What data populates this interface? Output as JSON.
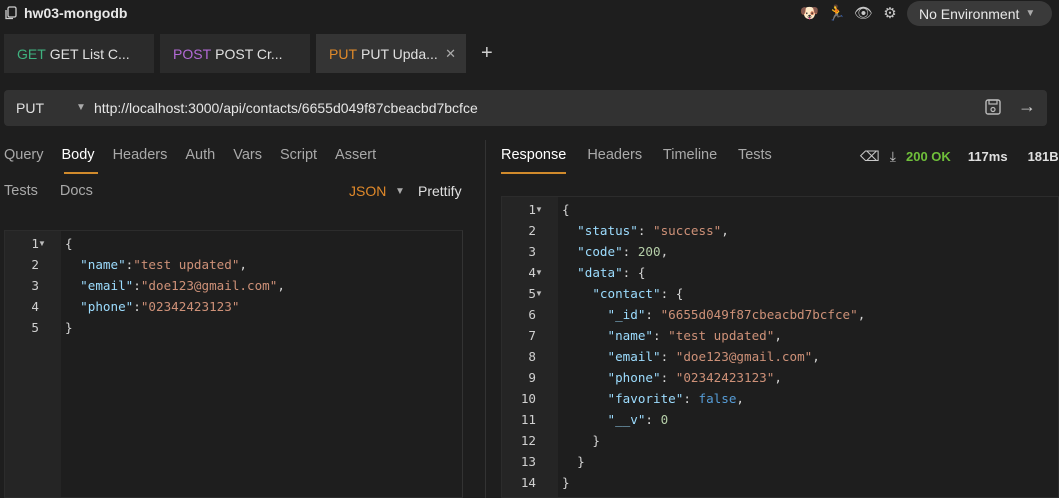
{
  "collection": {
    "name": "hw03-mongodb"
  },
  "environment": {
    "label": "No Environment"
  },
  "tabs": [
    {
      "method": "GET",
      "label": "GET List C...",
      "method_color": "#3fb27f"
    },
    {
      "method": "POST",
      "label": "POST Cr...",
      "method_color": "#b36ad6"
    },
    {
      "method": "PUT",
      "label": "PUT Upda...",
      "method_color": "#e08a2a",
      "active": true
    }
  ],
  "request": {
    "method": "PUT",
    "url": "http://localhost:3000/api/contacts/6655d049f87cbeacbd7bcfce",
    "tabs": [
      "Query",
      "Body",
      "Headers",
      "Auth",
      "Vars",
      "Script",
      "Assert"
    ],
    "tabs_row2": [
      "Tests",
      "Docs"
    ],
    "active_tab": "Body",
    "body_mode": "JSON",
    "prettify_label": "Prettify",
    "body_lines": [
      "{",
      "  \"name\":\"test updated\",",
      "  \"email\":\"doe123@gmail.com\",",
      "  \"phone\":\"02342423123\"",
      "}"
    ]
  },
  "response": {
    "tabs": [
      "Response",
      "Headers",
      "Timeline",
      "Tests"
    ],
    "active_tab": "Response",
    "status": "200 OK",
    "time": "117ms",
    "size": "181B",
    "lines": [
      "{",
      "  \"status\": \"success\",",
      "  \"code\": 200,",
      "  \"data\": {",
      "    \"contact\": {",
      "      \"_id\": \"6655d049f87cbeacbd7bcfce\",",
      "      \"name\": \"test updated\",",
      "      \"email\": \"doe123@gmail.com\",",
      "      \"phone\": \"02342423123\",",
      "      \"favorite\": false,",
      "      \"__v\": 0",
      "    }",
      "  }",
      "}"
    ]
  },
  "icons": {
    "collection": "copy-icon",
    "top": [
      "dog-icon",
      "runner-icon",
      "eye-icon",
      "gear-icon"
    ],
    "save": "save-icon",
    "send": "arrow-right-icon",
    "clear": "eraser-icon",
    "download": "download-icon"
  }
}
